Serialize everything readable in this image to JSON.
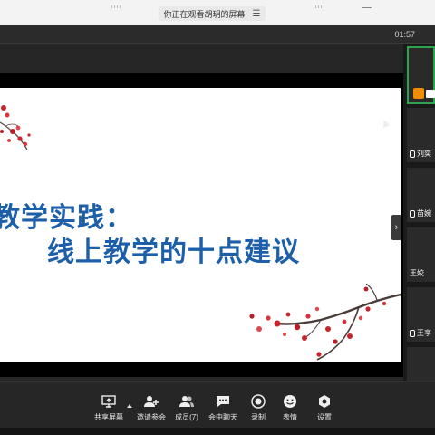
{
  "banner": {
    "text": "你正在观看胡玥的屏幕",
    "menu_icon": "list-icon"
  },
  "meeting": {
    "time": "01:57"
  },
  "slide": {
    "title_line1": "教学实践：",
    "title_line2": "线上教学的十点建议",
    "title_color": "#1d5fa8"
  },
  "participants": [
    {
      "name": "",
      "state": "active-speaker"
    },
    {
      "name": "刘奕",
      "mic": true
    },
    {
      "name": "苗婉",
      "mic": true
    },
    {
      "name": "王姣",
      "mic": false
    },
    {
      "name": "王亭",
      "mic": true
    }
  ],
  "toolbar": {
    "share_label": "共享屏幕",
    "invite_label": "邀请参会",
    "members_label": "成员(7)",
    "chat_label": "会中聊天",
    "record_label": "录制",
    "reaction_label": "表情",
    "settings_label": "设置"
  },
  "colors": {
    "accent_green": "#2da44e",
    "mic_orange": "#f08c00"
  }
}
